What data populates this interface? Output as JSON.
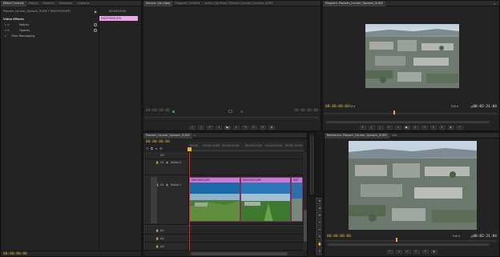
{
  "effect_controls": {
    "tabs": [
      "Effect Controls",
      "Project",
      "Markers",
      "Metadata",
      "Captions"
    ],
    "source_path": "Pioneer_Courier_Spinach_SUDS * DSCF9025.JPG",
    "clip_timecode": "00:00:05:00",
    "clip_name": "DSCF9025.JPG",
    "section_label": "Video Effects",
    "effects": [
      {
        "name": "Motion",
        "prefix": "▸ fx"
      },
      {
        "name": "Opacity",
        "prefix": "▸ fx"
      },
      {
        "name": "Time Remapping",
        "prefix": "▸"
      }
    ],
    "timecode": "00:00:00:00"
  },
  "source_monitor": {
    "tabs": [
      "Source: (no clips)",
      "Program: Untitled",
      "Audio Clip Mixer: Pioneer_Courier_Spinach_SUDS"
    ],
    "tc_left": "00:00:00:00",
    "tc_right": "00:00:00:00"
  },
  "program_top": {
    "tabs": [
      "Program: Pioneer_Courier_Spinach_SUDS"
    ],
    "tc_left": "00:00:00:00",
    "zoom": "Fit",
    "quality": "Full",
    "tc_right": "00:02:21:04"
  },
  "timeline": {
    "tabs": [
      "Pioneer_Courier_Spinach_SUDS"
    ],
    "timecode": "00:00:00:00",
    "ruler_labels": [
      "00:00",
      "00:00:15:00",
      "00:00:30:00",
      "00:00:45:00",
      "00:01:00:00",
      "00:01:15:00"
    ],
    "video_tracks": [
      {
        "id": "V3",
        "label": ""
      },
      {
        "id": "V2",
        "label": "Video 2"
      },
      {
        "id": "V1",
        "label": "Video 1"
      }
    ],
    "audio_tracks": [
      "A1",
      "A2",
      "A3"
    ],
    "clips": [
      "DSCF9025.JPG",
      "DSCF9025.JPG",
      "DSC"
    ]
  },
  "program_bottom": {
    "tabs": [
      "Reference: Pioneer_Courier_Spinach_SUDS",
      "Info"
    ],
    "tc_left": "00:00:00:00",
    "quality": "Full",
    "tc_right": "00:02:21:04"
  },
  "colors": {
    "timecode": "#e8b23a",
    "playhead": "#e03030",
    "clip_label": "#c77ad8",
    "clip_body": "#1a5a7a"
  }
}
